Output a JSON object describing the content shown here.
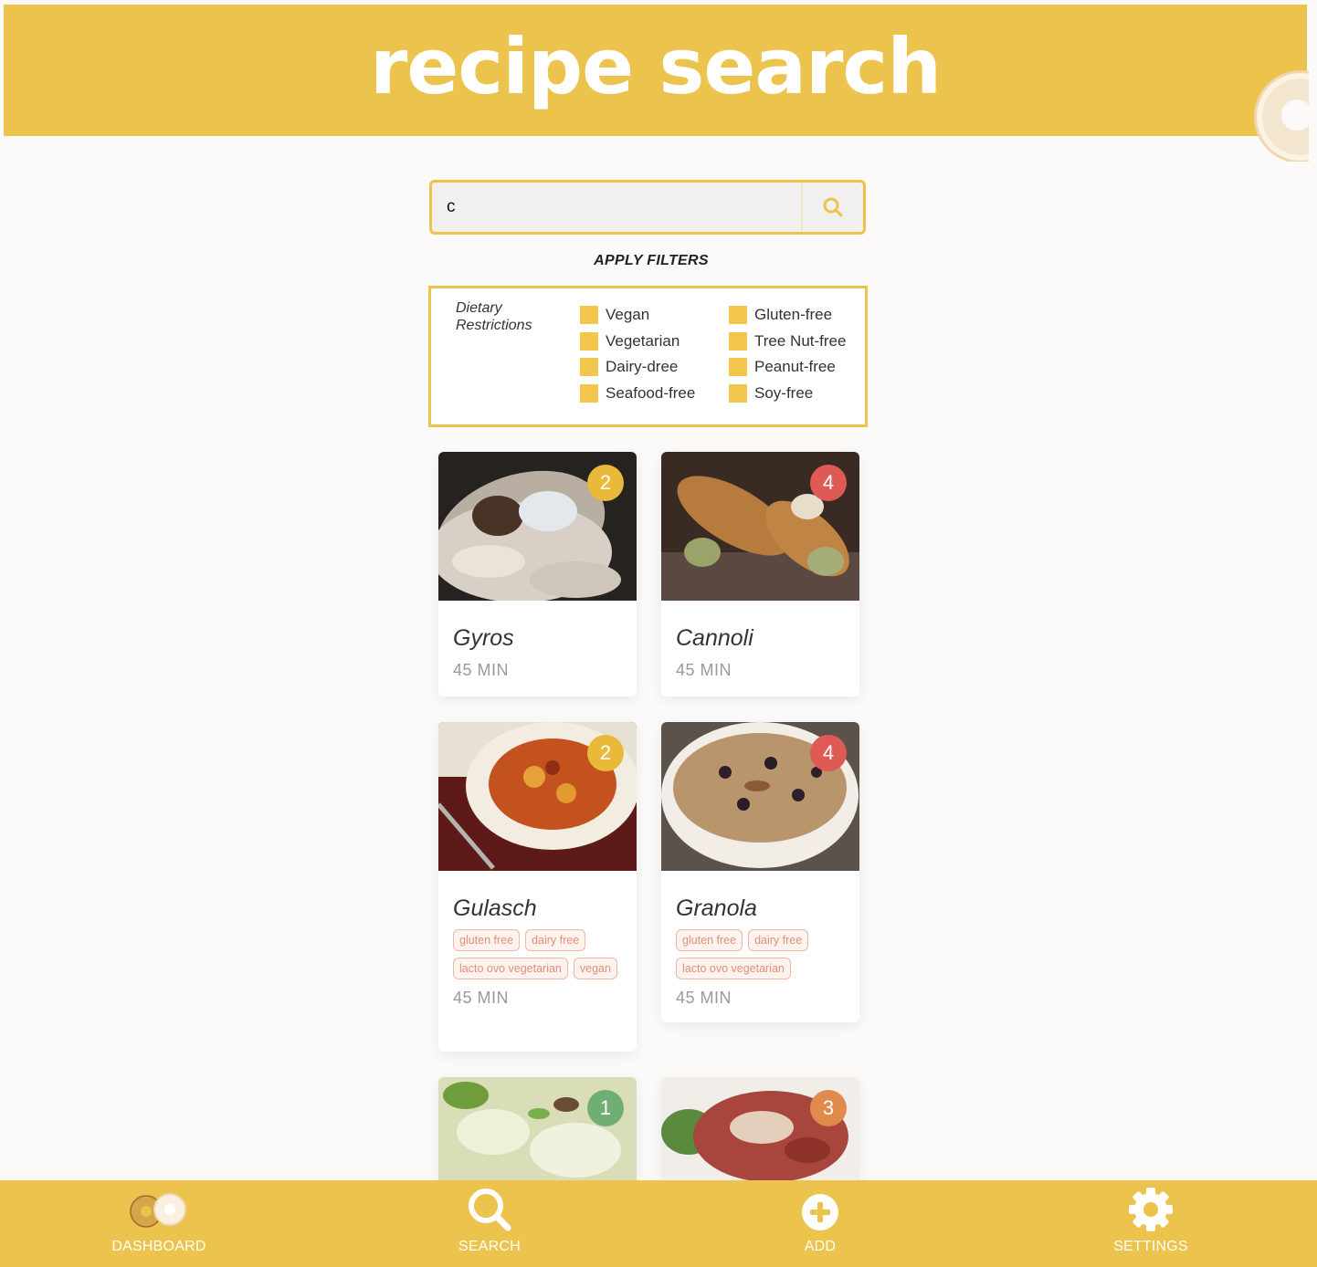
{
  "header": {
    "title": "recipe search"
  },
  "search": {
    "value": "c",
    "icon": "search-icon"
  },
  "filters": {
    "apply_label": "APPLY FILTERS",
    "group_label_line1": "Dietary",
    "group_label_line2": "Restrictions",
    "options": [
      "Vegan",
      "Vegetarian",
      "Dairy-dree",
      "Seafood-free",
      "Gluten-free",
      "Tree Nut-free",
      "Peanut-free",
      "Soy-free"
    ]
  },
  "recipes": [
    {
      "title": "Gyros",
      "badge": "2",
      "time": "45 MIN",
      "tags": []
    },
    {
      "title": "Cannoli",
      "badge": "4",
      "time": "45 MIN",
      "tags": []
    },
    {
      "title": "Gulasch",
      "badge": "2",
      "time": "45 MIN",
      "tags": [
        "gluten free",
        "dairy free",
        "lacto ovo vegetarian",
        "vegan"
      ]
    },
    {
      "title": "Granola",
      "badge": "4",
      "time": "45 MIN",
      "tags": [
        "gluten free",
        "dairy free",
        "lacto ovo vegetarian"
      ]
    },
    {
      "title": "",
      "badge": "1",
      "time": "",
      "tags": []
    },
    {
      "title": "",
      "badge": "3",
      "time": "",
      "tags": []
    }
  ],
  "colors": {
    "accent": "#ecc34d",
    "badge_yellow": "#e9b93a",
    "badge_red": "#e05a55",
    "badge_green": "#6fae75",
    "badge_orange": "#e08b4c",
    "tag_text": "#e0907a"
  },
  "nav": {
    "dashboard": "DASHBOARD",
    "search": "SEARCH",
    "add": "ADD",
    "settings": "SETTINGS"
  }
}
